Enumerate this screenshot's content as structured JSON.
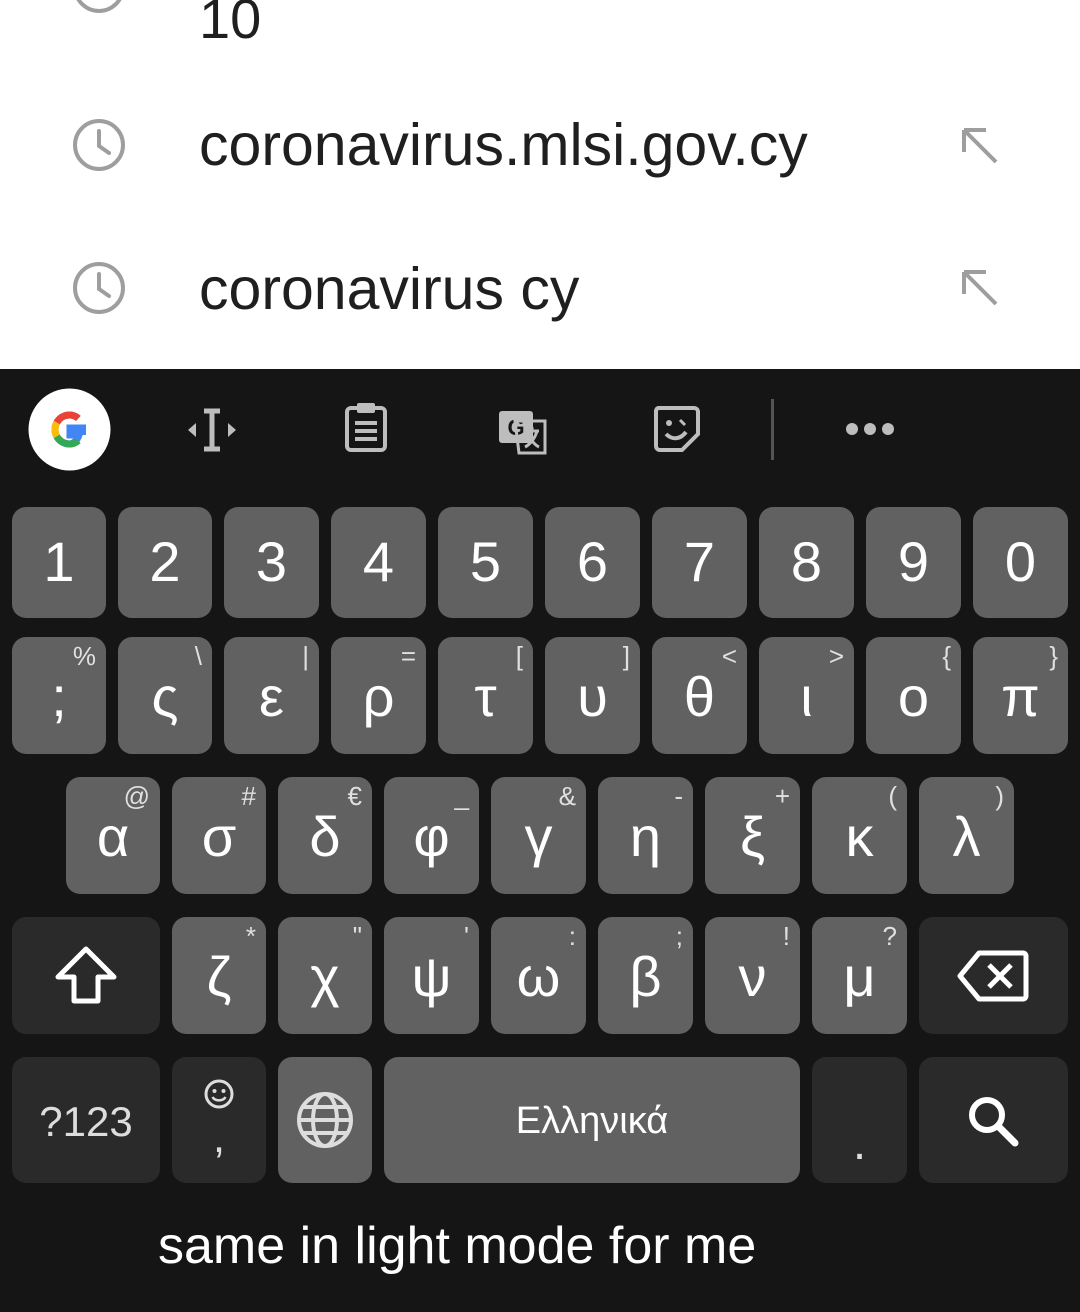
{
  "suggestions": {
    "partial_text": "10",
    "items": [
      {
        "text": "coronavirus.mlsi.gov.cy",
        "icon": "history-icon",
        "action_icon": "fill-query-arrow-icon"
      },
      {
        "text": "coronavirus cy",
        "icon": "history-icon",
        "action_icon": "fill-query-arrow-icon"
      }
    ]
  },
  "keyboard": {
    "toolbar": {
      "icons": [
        "google-icon",
        "cursor-control-icon",
        "clipboard-icon",
        "translate-icon",
        "sticker-icon",
        "more-icon"
      ]
    },
    "rows": [
      [
        {
          "label": "1"
        },
        {
          "label": "2"
        },
        {
          "label": "3"
        },
        {
          "label": "4"
        },
        {
          "label": "5"
        },
        {
          "label": "6"
        },
        {
          "label": "7"
        },
        {
          "label": "8"
        },
        {
          "label": "9"
        },
        {
          "label": "0"
        }
      ],
      [
        {
          "label": ";",
          "hint": "%"
        },
        {
          "label": "ς",
          "hint": "\\"
        },
        {
          "label": "ε",
          "hint": "|"
        },
        {
          "label": "ρ",
          "hint": "="
        },
        {
          "label": "τ",
          "hint": "["
        },
        {
          "label": "υ",
          "hint": "]"
        },
        {
          "label": "θ",
          "hint": "<"
        },
        {
          "label": "ι",
          "hint": ">"
        },
        {
          "label": "ο",
          "hint": "{"
        },
        {
          "label": "π",
          "hint": "}"
        }
      ],
      [
        {
          "label": "α",
          "hint": "@"
        },
        {
          "label": "σ",
          "hint": "#"
        },
        {
          "label": "δ",
          "hint": "€"
        },
        {
          "label": "φ",
          "hint": "_"
        },
        {
          "label": "γ",
          "hint": "&"
        },
        {
          "label": "η",
          "hint": "-"
        },
        {
          "label": "ξ",
          "hint": "+"
        },
        {
          "label": "κ",
          "hint": "("
        },
        {
          "label": "λ",
          "hint": ")"
        }
      ],
      [
        {
          "label": "ζ",
          "hint": "*"
        },
        {
          "label": "χ",
          "hint": "\""
        },
        {
          "label": "ψ",
          "hint": "'"
        },
        {
          "label": "ω",
          "hint": ":"
        },
        {
          "label": "β",
          "hint": ";"
        },
        {
          "label": "ν",
          "hint": "!"
        },
        {
          "label": "μ",
          "hint": "?"
        }
      ]
    ],
    "bottom_row": {
      "symbols_label": "?123",
      "comma_label": ",",
      "space_label": "Ελληνικά",
      "period_label": "."
    },
    "colors": {
      "key": "#616161",
      "dark_key": "#2a2a2a",
      "background": "#151515"
    }
  },
  "caption": "same in light mode for me"
}
